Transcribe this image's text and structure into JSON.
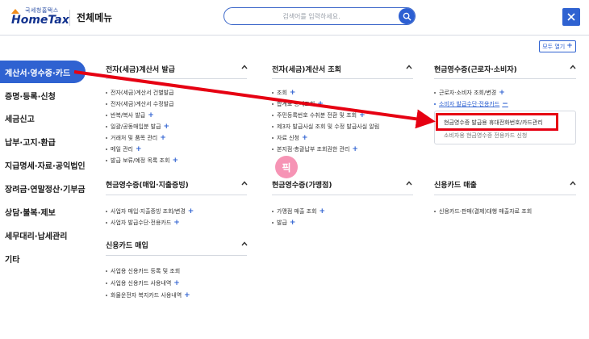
{
  "header": {
    "logo_sub": "국세청홈택스",
    "logo_main": "HomeTax",
    "menu_title": "전체메뉴",
    "search_placeholder": "검색어를 입력하세요.",
    "expand_all_label": "모두 열기"
  },
  "sidebar": {
    "items": [
      {
        "label": "계산서·영수증·카드",
        "active": true
      },
      {
        "label": "증명·등록·신청"
      },
      {
        "label": "세금신고"
      },
      {
        "label": "납부·고지·환급"
      },
      {
        "label": "지급명세·자료·공익법인"
      },
      {
        "label": "장려금·연말정산·기부금"
      },
      {
        "label": "상담·불복·제보"
      },
      {
        "label": "세무대리·납세관리"
      },
      {
        "label": "기타"
      }
    ]
  },
  "sections": {
    "etax_issue": {
      "title": "전자(세금)계산서 발급",
      "items": [
        "전자(세금)계산서 건별발급",
        "전자(세금)계산서 수정발급",
        "반복/복사 발급",
        "일괄/공동매입분 발급",
        "거래처 및 품목 관리",
        "메일 관리",
        "발급 보류/예정 목록 조회"
      ]
    },
    "etax_query": {
      "title": "전자(세금)계산서 조회",
      "items": [
        "조회",
        "합계표 통계조회",
        "주민등록번호 수취분 전환 및 조회",
        "제3자 발급사실 조회 및 수정 발급사실 알림",
        "자료 신청",
        "본지점·총괄납부 조회권한 관리"
      ]
    },
    "cash_receipt_consumer": {
      "title": "현금영수증(근로자·소비자)",
      "items": [
        "근로자·소비자 조회/변경",
        "소비자 발급수단·전용카드"
      ],
      "sub_items": [
        "현금영수증 발급용 휴대전화번호/카드관리",
        "소비자용 현금영수증 전용카드 신청"
      ]
    },
    "cash_receipt_business": {
      "title": "현금영수증(매입·지출증빙)",
      "items": [
        "사업자 매입·지출증빙 조회/변경",
        "사업자 발급수단·전용카드"
      ]
    },
    "cash_receipt_merchant": {
      "title": "현금영수증(가맹점)",
      "items": [
        "가맹점 매출 조회",
        "발급"
      ]
    },
    "credit_sales": {
      "title": "신용카드 매출",
      "items": [
        "신용카드·판매(결제)대행 매출자료 조회"
      ]
    },
    "credit_purchase": {
      "title": "신용카드 매입",
      "items": [
        "사업용 신용카드 등록 및 조회",
        "사업용 신용카드 사용내역",
        "화물운전자 복지카드 사용내역"
      ]
    }
  },
  "watermark": "픽",
  "colors": {
    "accent": "#2f62d1",
    "annotation_red": "#e60012",
    "watermark_pink": "#f47aa3"
  }
}
